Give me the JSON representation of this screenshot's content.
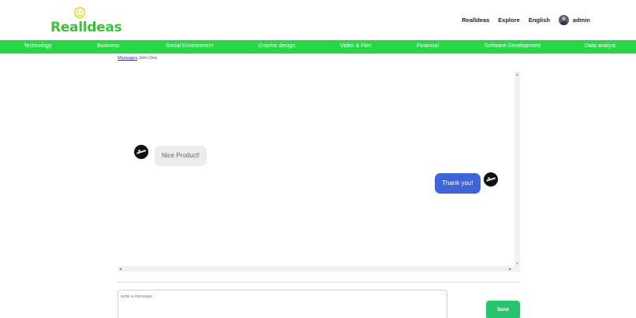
{
  "brand": {
    "name": "Realldeas",
    "color": "#3fbf3a"
  },
  "top_nav": {
    "items": [
      "Realldeas",
      "Explore",
      "English"
    ],
    "user": "admin"
  },
  "categories": [
    "Technology",
    "Business",
    "Social Environment",
    "Graphic design",
    "Video & Film",
    "Financial",
    "Software Development",
    "Data analyst"
  ],
  "category_bar_color": "#2ad648",
  "breadcrumb": {
    "link": "Messages",
    "current": "John Doe"
  },
  "messages": [
    {
      "direction": "in",
      "text": "Nice Product!"
    },
    {
      "direction": "out",
      "text": "Thank you!"
    }
  ],
  "composer": {
    "placeholder": "write a message",
    "send_label": "Send"
  },
  "colors": {
    "outgoing_bubble": "#3f63d8",
    "send_button": "#27c46f"
  }
}
